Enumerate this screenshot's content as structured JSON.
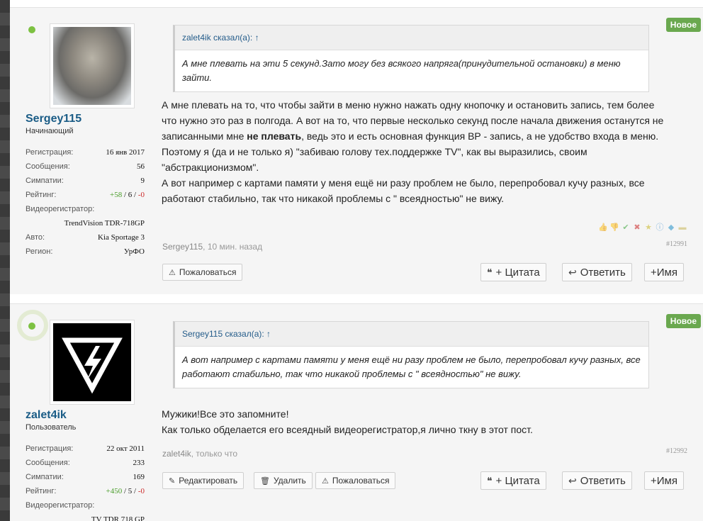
{
  "posts": [
    {
      "badge": "Новое",
      "username": "Sergey115",
      "usertitle": "Начинающий",
      "stats": {
        "reg_k": "Регистрация:",
        "reg_v": "16 янв 2017",
        "msg_k": "Сообщения:",
        "msg_v": "56",
        "likes_k": "Симпатии:",
        "likes_v": "9",
        "rating_k": "Рейтинг:",
        "rating_pos": "+58",
        "rating_mid": " / 6 / ",
        "rating_neg": "-0",
        "dvr_k": "Видеорегистратор:",
        "dvr_v": "TrendVision TDR-718GP",
        "car_k": "Авто:",
        "car_v": "Kia Sportage 3",
        "region_k": "Регион:",
        "region_v": "УрФО"
      },
      "quote_head": "zalet4ik сказал(а): ↑",
      "quote_body": "А мне плевать на эти 5 секунд.Зато могу без всякого напряга(принудительной остановки) в меню зайти.",
      "message_part1": "А мне плевать на то, что чтобы зайти в меню нужно нажать одну кнопочку и остановить запись, тем более что нужно это раз в полгода. А вот на то, что первые несколько секунд после начала движения останутся не записанными мне ",
      "message_bold": "не плевать",
      "message_part2": ", ведь это и есть основная функция ВР - запись, а не удобство входа в меню. Поэтому я (да и не только я) \"забиваю голову тех.поддержке TV\", как вы выразились, своим \"абстракционизмом\".",
      "message_part3": "А вот например с картами памяти у меня ещё ни разу проблем не было, перепробовал кучу разных, все работают стабильно, так что никакой проблемы с \" всеядностью\" не вижу.",
      "meta_author": "Sergey115",
      "meta_when": ", 10 мин. назад",
      "post_number": "#12991",
      "btn_report": "Пожаловаться",
      "btn_quote": "+ Цитата",
      "btn_reply": "Ответить",
      "btn_name": "+Имя"
    },
    {
      "badge": "Новое",
      "username": "zalet4ik",
      "usertitle": "Пользователь",
      "stats": {
        "reg_k": "Регистрация:",
        "reg_v": "22 окт 2011",
        "msg_k": "Сообщения:",
        "msg_v": "233",
        "likes_k": "Симпатии:",
        "likes_v": "169",
        "rating_k": "Рейтинг:",
        "rating_pos": "+450",
        "rating_mid": " / 5 / ",
        "rating_neg": "-0",
        "dvr_k": "Видеорегистратор:",
        "dvr_v": "TV TDR 718 GP"
      },
      "quote_head": "Sergey115 сказал(а): ↑",
      "quote_body": "А вот например с картами памяти у меня ещё ни разу проблем не было, перепробовал кучу разных, все работают стабильно, так что никакой проблемы с \" всеядностью\" не вижу.",
      "message_line1": "Мужики!Все это запомните!",
      "message_line2": "Как только обделается его всеядный видеорегистратор,я лично ткну в этот пост.",
      "meta_author": "zalet4ik",
      "meta_when": ", только что",
      "post_number": "#12992",
      "btn_edit": "Редактировать",
      "btn_delete": "Удалить",
      "btn_report": "Пожаловаться",
      "btn_quote": "+ Цитата",
      "btn_reply": "Ответить",
      "btn_name": "+Имя"
    }
  ],
  "colors": {
    "online": "#7dc142",
    "badge": "#6aa84f",
    "username": "#1a5c86"
  },
  "icons": [
    "warning-icon",
    "quote-icon",
    "reply-icon",
    "pencil-icon",
    "trash-icon",
    "like-icon",
    "dislike-icon",
    "check-icon",
    "cross-icon",
    "star-icon",
    "info-icon",
    "diamond-icon",
    "folder-icon"
  ]
}
